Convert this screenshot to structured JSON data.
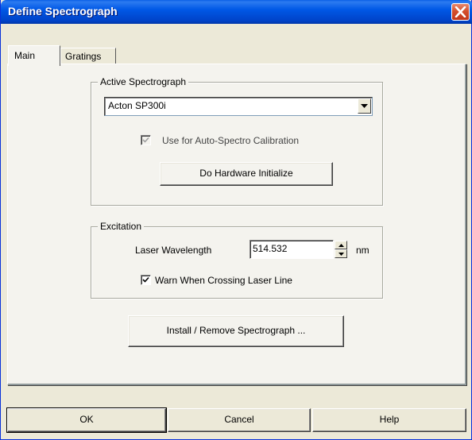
{
  "window": {
    "title": "Define Spectrograph"
  },
  "tabs": [
    {
      "label": "Main",
      "active": true
    },
    {
      "label": "Gratings",
      "active": false
    }
  ],
  "active_spectrograph": {
    "legend": "Active Spectrograph",
    "selected": "Acton SP300i",
    "auto_calibration_label": "Use for Auto-Spectro Calibration",
    "auto_calibration_checked": true,
    "auto_calibration_enabled": false,
    "hardware_init_label": "Do Hardware Initialize"
  },
  "excitation": {
    "legend": "Excitation",
    "laser_label": "Laser Wavelength",
    "laser_value": "514.532",
    "unit": "nm",
    "warn_label": "Warn When Crossing Laser Line",
    "warn_checked": true
  },
  "install_label": "Install / Remove Spectrograph ...",
  "buttons": {
    "ok": "OK",
    "cancel": "Cancel",
    "help": "Help"
  },
  "icons": {
    "close": "close-icon",
    "dropdown": "chevron-down-icon",
    "check": "checkmark-icon",
    "spin_up": "arrow-up-icon",
    "spin_down": "arrow-down-icon"
  },
  "colors": {
    "titlebar": "#0058e6",
    "close": "#d4502d"
  }
}
